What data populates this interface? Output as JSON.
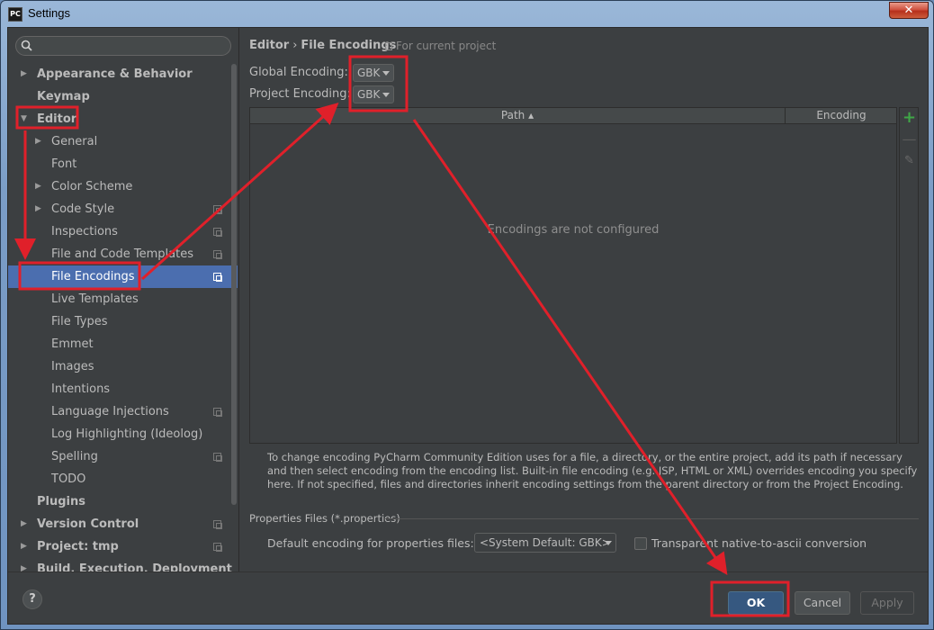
{
  "window": {
    "title": "Settings",
    "app_icon_text": "PC",
    "close_label": "✕"
  },
  "sidebar": {
    "search_placeholder": "",
    "items": [
      {
        "label": "Appearance & Behavior",
        "level": 0,
        "bold": true,
        "arrow": "▶"
      },
      {
        "label": "Keymap",
        "level": 0,
        "bold": true,
        "arrow": ""
      },
      {
        "label": "Editor",
        "level": 0,
        "bold": true,
        "arrow": "▼"
      },
      {
        "label": "General",
        "level": 1,
        "arrow": "▶"
      },
      {
        "label": "Font",
        "level": 1,
        "arrow": ""
      },
      {
        "label": "Color Scheme",
        "level": 1,
        "arrow": "▶"
      },
      {
        "label": "Code Style",
        "level": 1,
        "arrow": "▶",
        "project": true
      },
      {
        "label": "Inspections",
        "level": 1,
        "arrow": "",
        "project": true
      },
      {
        "label": "File and Code Templates",
        "level": 1,
        "arrow": "",
        "project": true
      },
      {
        "label": "File Encodings",
        "level": 1,
        "arrow": "",
        "project": true,
        "selected": true
      },
      {
        "label": "Live Templates",
        "level": 1,
        "arrow": ""
      },
      {
        "label": "File Types",
        "level": 1,
        "arrow": ""
      },
      {
        "label": "Emmet",
        "level": 1,
        "arrow": ""
      },
      {
        "label": "Images",
        "level": 1,
        "arrow": ""
      },
      {
        "label": "Intentions",
        "level": 1,
        "arrow": ""
      },
      {
        "label": "Language Injections",
        "level": 1,
        "arrow": "",
        "project": true
      },
      {
        "label": "Log Highlighting (Ideolog)",
        "level": 1,
        "arrow": ""
      },
      {
        "label": "Spelling",
        "level": 1,
        "arrow": "",
        "project": true
      },
      {
        "label": "TODO",
        "level": 1,
        "arrow": ""
      },
      {
        "label": "Plugins",
        "level": 0,
        "bold": true,
        "arrow": ""
      },
      {
        "label": "Version Control",
        "level": 0,
        "bold": true,
        "arrow": "▶",
        "project": true
      },
      {
        "label": "Project: tmp",
        "level": 0,
        "bold": true,
        "arrow": "▶",
        "project": true
      },
      {
        "label": "Build, Execution, Deployment",
        "level": 0,
        "bold": true,
        "arrow": "▶"
      }
    ]
  },
  "main": {
    "breadcrumb_parent": "Editor",
    "breadcrumb_sep": "›",
    "breadcrumb_current": "File Encodings",
    "for_current_project": "For current project",
    "global_encoding_label": "Global Encoding:",
    "global_encoding_value": "GBK",
    "project_encoding_label": "Project Encoding:",
    "project_encoding_value": "GBK",
    "table": {
      "col_path": "Path ▴",
      "col_encoding": "Encoding",
      "empty_text": "Encodings are not configured"
    },
    "tools": {
      "add": "+",
      "remove": "—",
      "edit": "✎"
    },
    "description": "To change encoding PyCharm Community Edition uses for a file, a directory, or the entire project, add its path if necessary and then select encoding from the encoding list. Built-in file encoding (e.g. JSP, HTML or XML) overrides encoding you specify here. If not specified, files and directories inherit encoding settings from the parent directory or from the Project Encoding.",
    "properties_section": "Properties Files (*.properties)",
    "default_props_label": "Default encoding for properties files:",
    "default_props_value": "<System Default: GBK>",
    "native_ascii_label": "Transparent native-to-ascii conversion",
    "native_ascii_checked": false
  },
  "footer": {
    "help_label": "?",
    "ok_label": "OK",
    "cancel_label": "Cancel",
    "apply_label": "Apply"
  },
  "colors": {
    "annotation_red": "#e0202a",
    "selection_blue": "#4b6eaf",
    "panel_bg": "#3c3f41"
  }
}
